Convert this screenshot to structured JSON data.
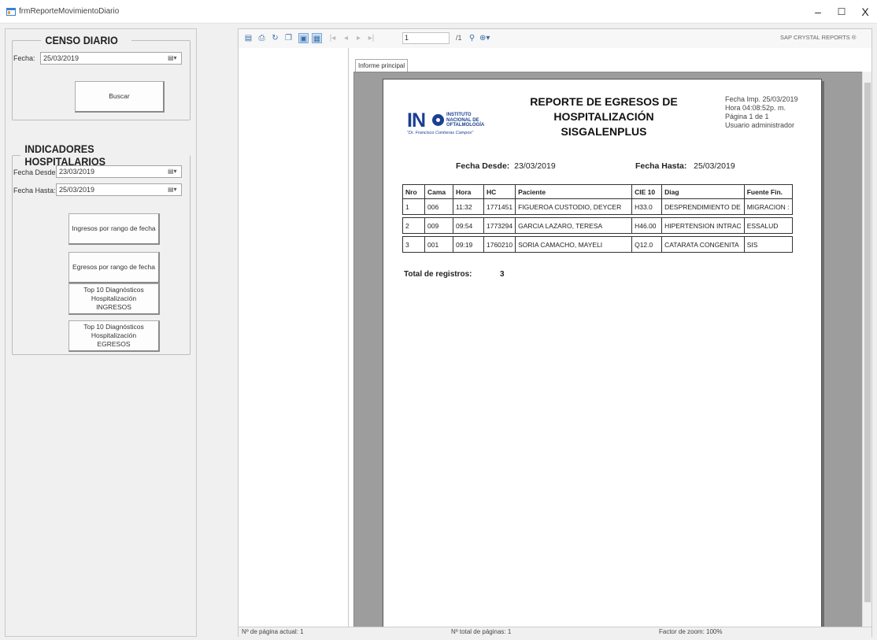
{
  "window": {
    "title": "frmReporteMovimientoDiario",
    "minimize": "–",
    "maximize": "☐",
    "close": "X"
  },
  "censo": {
    "legend": "CENSO DIARIO",
    "fecha_label": "Fecha:",
    "fecha_value": "25/03/2019",
    "buscar_label": "Buscar"
  },
  "indicadores": {
    "legend": "INDICADORES HOSPITALARIOS",
    "desde_label": "Fecha Desde:",
    "desde_value": "23/03/2019",
    "hasta_label": "Fecha Hasta:",
    "hasta_value": "25/03/2019",
    "btn_ingresos": "Ingresos por rango de fecha",
    "btn_egresos": "Egresos por rango de fecha",
    "btn_top_ingresos": "Top 10 Diagnósticos Hospitalización INGRESOS",
    "btn_top_egresos": "Top 10 Diagnósticos Hospitalización EGRESOS"
  },
  "viewer": {
    "page_input": "1",
    "page_of": "/1",
    "brand": "SAP CRYSTAL REPORTS ®",
    "tab_label": "Informe principal",
    "status_current": "Nº de página actual: 1",
    "status_total": "Nº total de páginas: 1",
    "status_zoom": "Factor de zoom: 100%"
  },
  "report": {
    "title_line1": "REPORTE DE EGRESOS DE",
    "title_line2": "HOSPITALIZACIÓN",
    "title_line3": "SISGALENPLUS",
    "fecha_imp": "Fecha Imp. 25/03/2019",
    "hora": "Hora    04:08:52p. m.",
    "pagina": "Página 1 de 1",
    "usuario": "Usuario    administrador",
    "logo_ino": "IN",
    "logo_inst": "INSTITUTO\nNACIONAL DE\nOFTALMOLOGÍA",
    "logo_motto": "\"Dr. Francisco Contreras Campos\"",
    "desde_label": "Fecha Desde:",
    "desde_value": "23/03/2019",
    "hasta_label": "Fecha Hasta:",
    "hasta_value": "25/03/2019",
    "columns": [
      "Nro",
      "Cama",
      "Hora",
      "HC",
      "Paciente",
      "CIE 10",
      "Diag",
      "Fuente Fin."
    ],
    "rows": [
      [
        "1",
        "006",
        "11:32",
        "1771451",
        "FIGUEROA CUSTODIO, DEYCER",
        "H33.0",
        "DESPRENDIMIENTO DE",
        "MIGRACION :"
      ],
      [
        "2",
        "009",
        "09:54",
        "1773294",
        "GARCIA LAZARO, TERESA",
        "H46.00",
        "HIPERTENSION INTRAC",
        "ESSALUD"
      ],
      [
        "3",
        "001",
        "09:19",
        "1760210",
        "SORIA CAMACHO, MAYELI",
        "Q12.0",
        "CATARATA CONGENITA",
        "SIS"
      ]
    ],
    "total_label": "Total de registros:",
    "total_value": "3"
  }
}
